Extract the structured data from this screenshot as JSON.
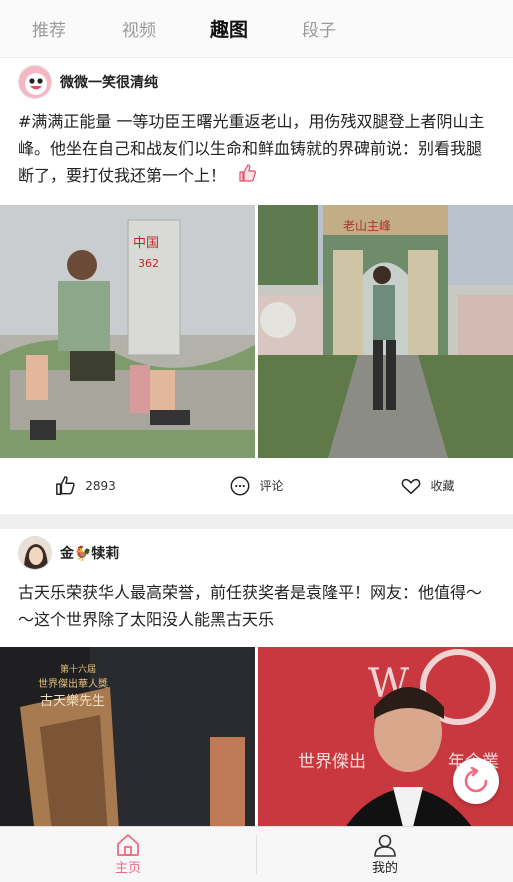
{
  "tabs": [
    {
      "label": "推荐",
      "active": false
    },
    {
      "label": "视频",
      "active": false
    },
    {
      "label": "趣图",
      "active": true
    },
    {
      "label": "段子",
      "active": false
    }
  ],
  "posts": [
    {
      "user": "微微一笑很清纯",
      "text": "#满满正能量 一等功臣王曙光重返老山，用伤残双腿登上者阴山主峰。他坐在自己和战友们以生命和鲜血铸就的界碑前说：别看我腿断了，要打仗我还第一个上！",
      "images": [
        {
          "caption_text": "中国 362"
        },
        {
          "caption_text": "老山主峰 者阴山主峰"
        }
      ],
      "likes": "2893",
      "comment_label": "评论",
      "favorite_label": "收藏"
    },
    {
      "user": "金🐓犊莉",
      "text": "古天乐荣获华人最高荣誉，前任获奖者是袁隆平！网友：他值得～～这个世界除了太阳没人能黑古天乐",
      "images": [
        {
          "caption_text": "第十六屆 世界傑出華人獎 古天樂先生"
        },
        {
          "caption_text": "世界傑出華人獎 年企業"
        }
      ]
    }
  ],
  "bottom_nav": [
    {
      "label": "主页",
      "active": true
    },
    {
      "label": "我的",
      "active": false
    }
  ],
  "colors": {
    "accent": "#f06b86",
    "text": "#222222",
    "muted": "#9a9a9a"
  }
}
